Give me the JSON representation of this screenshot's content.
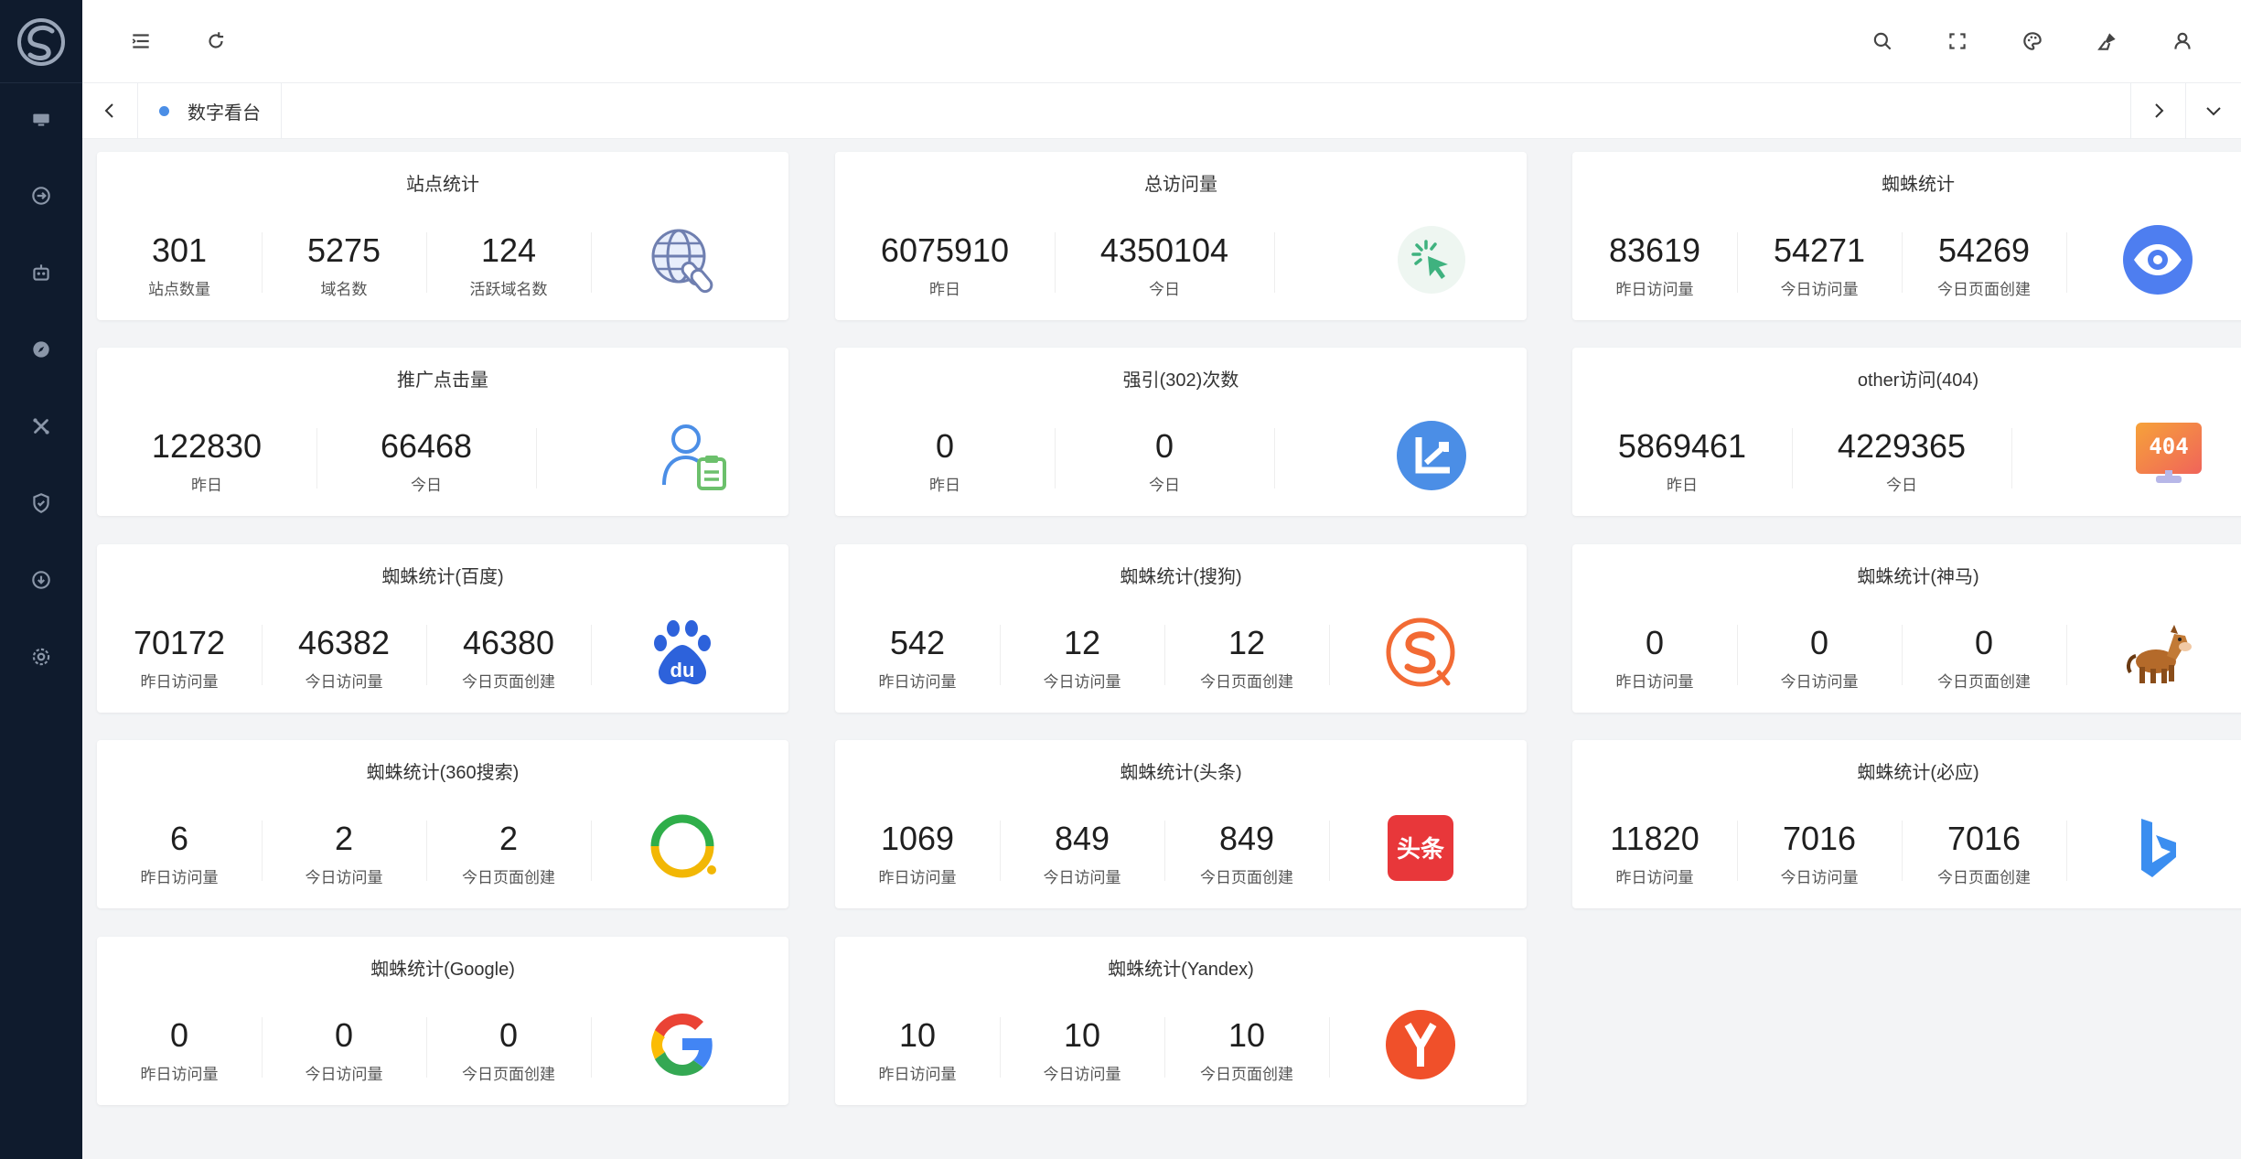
{
  "sidebar": {
    "icons": [
      "dashboard-icon",
      "exchange-icon",
      "robot-icon",
      "compass-icon",
      "tools-icon",
      "shield-icon",
      "download-icon",
      "settings-icon"
    ]
  },
  "header": {
    "icons": [
      "menu-fold-icon",
      "refresh-icon",
      "search-icon",
      "fullscreen-icon",
      "palette-icon",
      "clean-icon",
      "user-icon"
    ]
  },
  "tabs": [
    {
      "label": "数字看台",
      "active": true
    }
  ],
  "colors": {
    "sidebar_bg": "#0f1b2d",
    "accent": "#4b8ee6",
    "page_bg": "#f3f4f6"
  },
  "cards": [
    {
      "title": "站点统计",
      "icon": "globe-link-icon",
      "stats": [
        {
          "value": "301",
          "label": "站点数量"
        },
        {
          "value": "5275",
          "label": "域名数"
        },
        {
          "value": "124",
          "label": "活跃域名数"
        }
      ]
    },
    {
      "title": "总访问量",
      "icon": "click-icon",
      "stats": [
        {
          "value": "6075910",
          "label": "昨日"
        },
        {
          "value": "4350104",
          "label": "今日"
        }
      ]
    },
    {
      "title": "蜘蛛统计",
      "icon": "eye-icon",
      "stats": [
        {
          "value": "83619",
          "label": "昨日访问量"
        },
        {
          "value": "54271",
          "label": "今日访问量"
        },
        {
          "value": "54269",
          "label": "今日页面创建"
        }
      ]
    },
    {
      "title": "推广点击量",
      "icon": "user-report-icon",
      "stats": [
        {
          "value": "122830",
          "label": "昨日"
        },
        {
          "value": "66468",
          "label": "今日"
        }
      ]
    },
    {
      "title": "强引(302)次数",
      "icon": "redirect-icon",
      "stats": [
        {
          "value": "0",
          "label": "昨日"
        },
        {
          "value": "0",
          "label": "今日"
        }
      ]
    },
    {
      "title": "other访问(404)",
      "icon": "404-icon",
      "stats": [
        {
          "value": "5869461",
          "label": "昨日"
        },
        {
          "value": "4229365",
          "label": "今日"
        }
      ]
    },
    {
      "title": "蜘蛛统计(百度)",
      "icon": "baidu-icon",
      "stats": [
        {
          "value": "70172",
          "label": "昨日访问量"
        },
        {
          "value": "46382",
          "label": "今日访问量"
        },
        {
          "value": "46380",
          "label": "今日页面创建"
        }
      ]
    },
    {
      "title": "蜘蛛统计(搜狗)",
      "icon": "sogou-icon",
      "stats": [
        {
          "value": "542",
          "label": "昨日访问量"
        },
        {
          "value": "12",
          "label": "今日访问量"
        },
        {
          "value": "12",
          "label": "今日页面创建"
        }
      ]
    },
    {
      "title": "蜘蛛统计(神马)",
      "icon": "shenma-horse-icon",
      "stats": [
        {
          "value": "0",
          "label": "昨日访问量"
        },
        {
          "value": "0",
          "label": "今日访问量"
        },
        {
          "value": "0",
          "label": "今日页面创建"
        }
      ]
    },
    {
      "title": "蜘蛛统计(360搜索)",
      "icon": "360-search-icon",
      "stats": [
        {
          "value": "6",
          "label": "昨日访问量"
        },
        {
          "value": "2",
          "label": "今日访问量"
        },
        {
          "value": "2",
          "label": "今日页面创建"
        }
      ]
    },
    {
      "title": "蜘蛛统计(头条)",
      "icon": "toutiao-icon",
      "icon_text": "头条",
      "stats": [
        {
          "value": "1069",
          "label": "昨日访问量"
        },
        {
          "value": "849",
          "label": "今日访问量"
        },
        {
          "value": "849",
          "label": "今日页面创建"
        }
      ]
    },
    {
      "title": "蜘蛛统计(必应)",
      "icon": "bing-icon",
      "stats": [
        {
          "value": "11820",
          "label": "昨日访问量"
        },
        {
          "value": "7016",
          "label": "今日访问量"
        },
        {
          "value": "7016",
          "label": "今日页面创建"
        }
      ]
    },
    {
      "title": "蜘蛛统计(Google)",
      "icon": "google-icon",
      "stats": [
        {
          "value": "0",
          "label": "昨日访问量"
        },
        {
          "value": "0",
          "label": "今日访问量"
        },
        {
          "value": "0",
          "label": "今日页面创建"
        }
      ]
    },
    {
      "title": "蜘蛛统计(Yandex)",
      "icon": "yandex-icon",
      "stats": [
        {
          "value": "10",
          "label": "昨日访问量"
        },
        {
          "value": "10",
          "label": "今日访问量"
        },
        {
          "value": "10",
          "label": "今日页面创建"
        }
      ]
    }
  ]
}
